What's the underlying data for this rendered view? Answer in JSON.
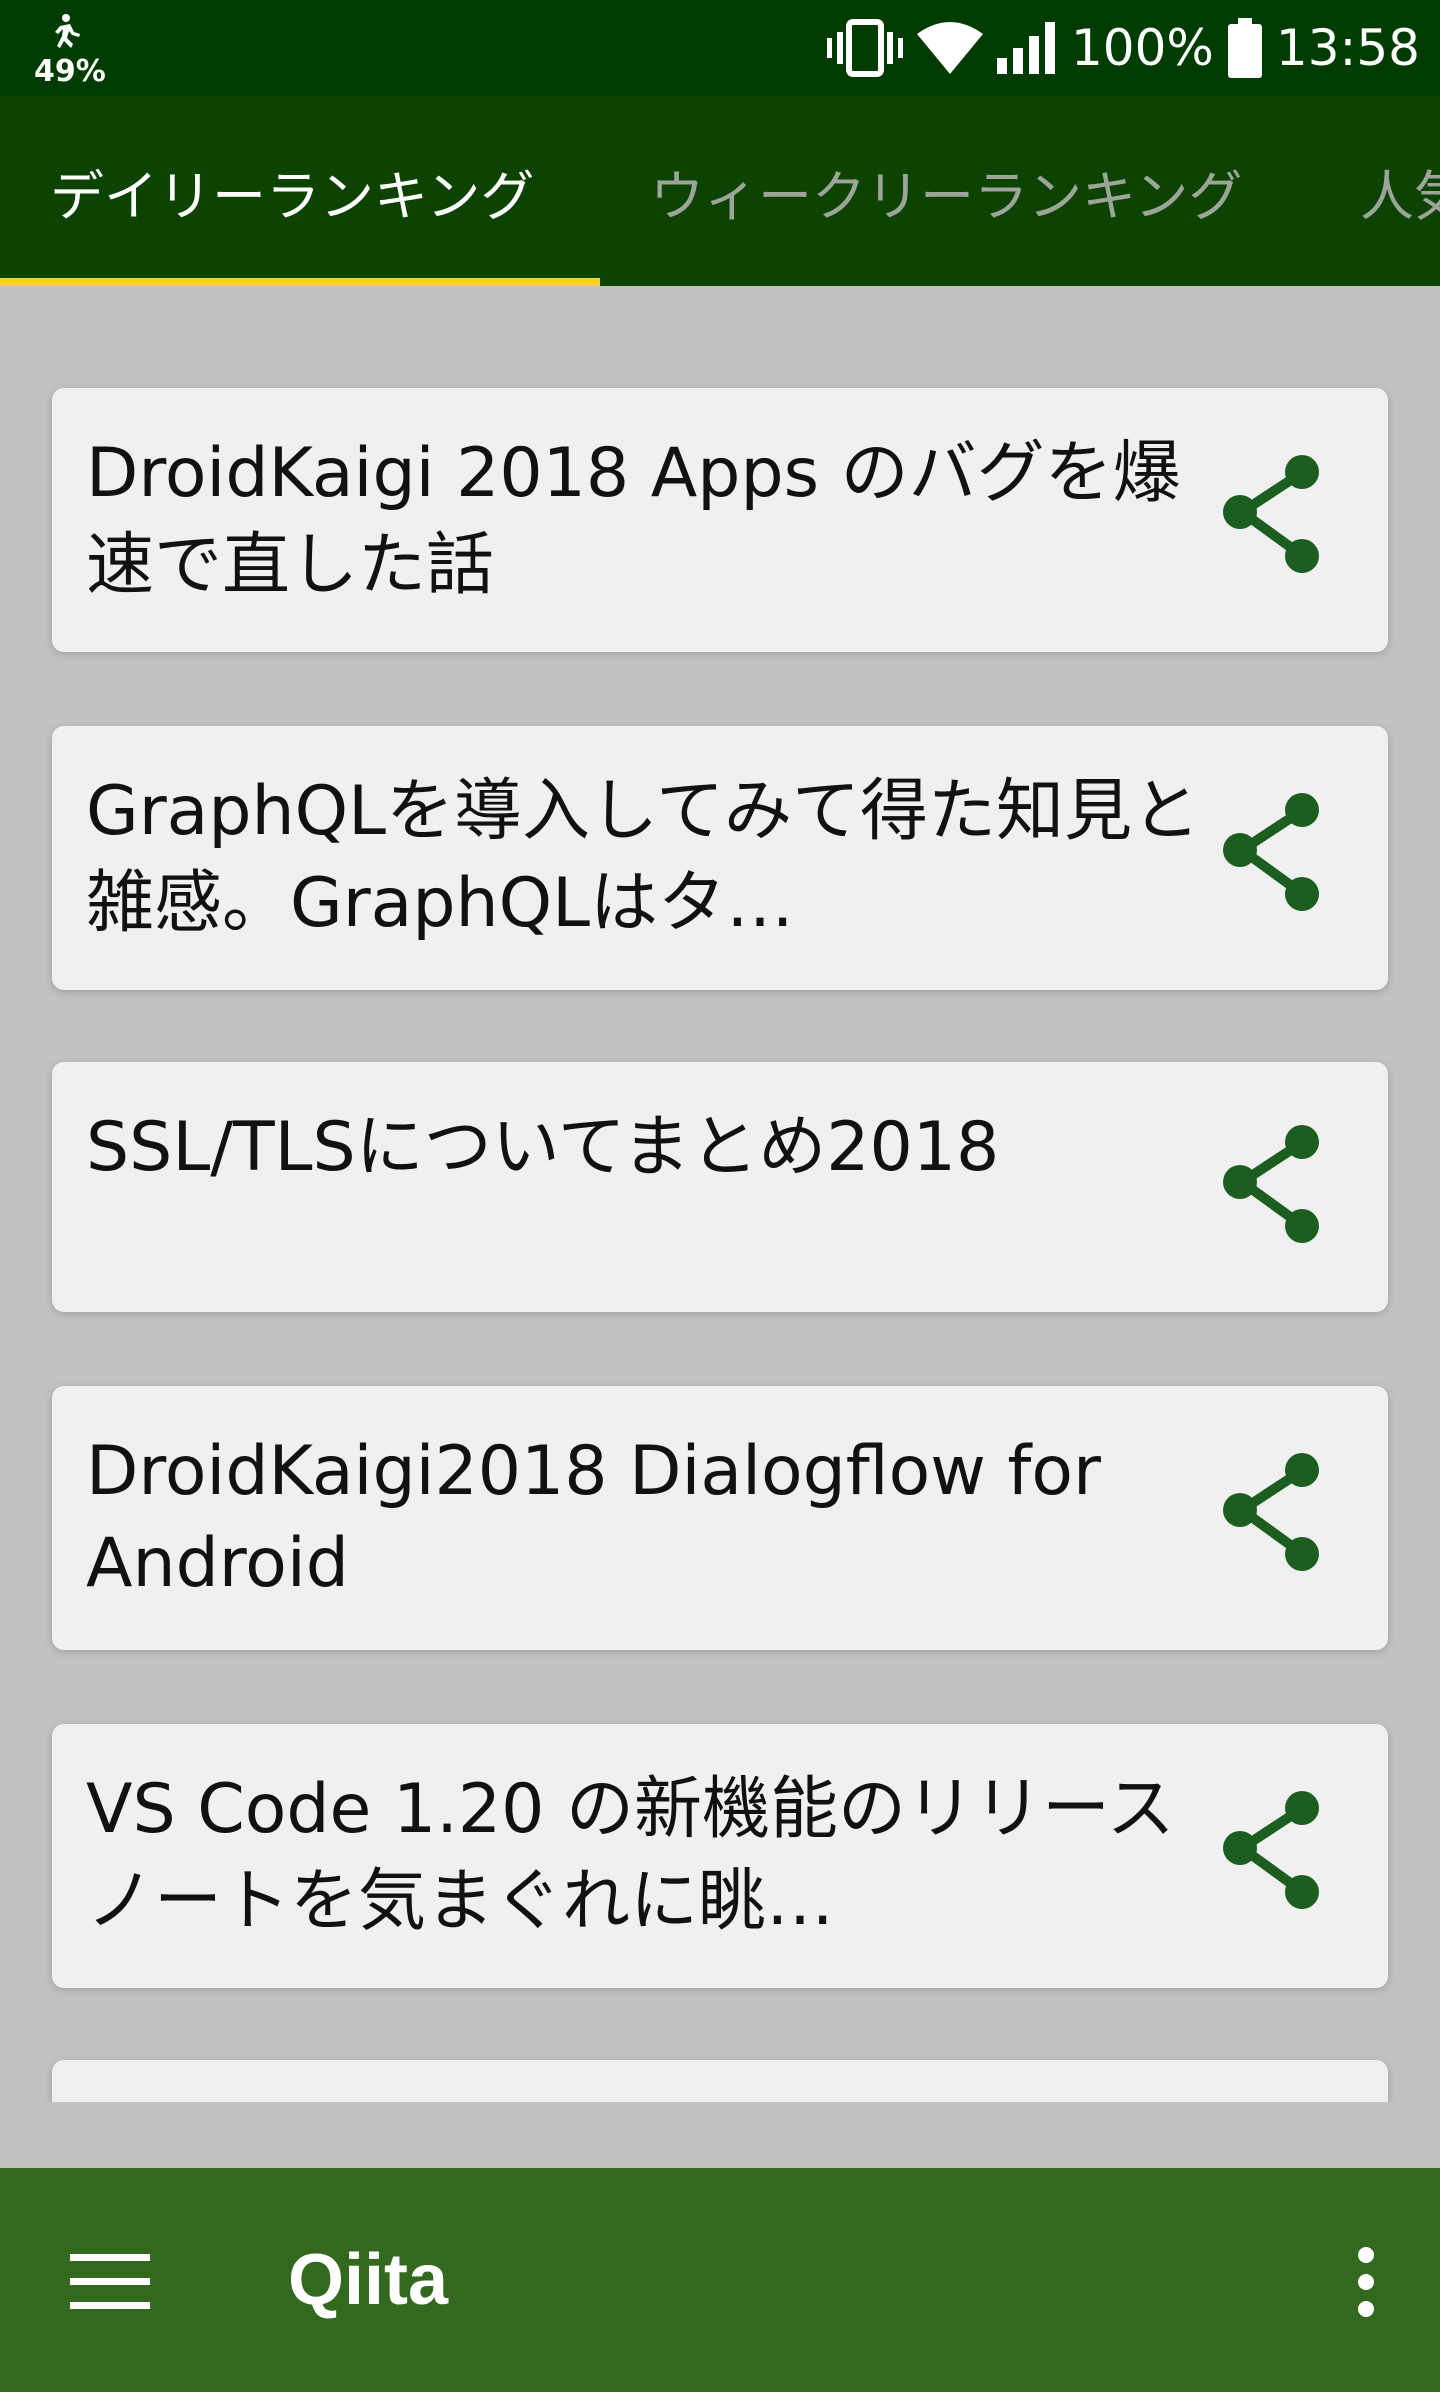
{
  "status_bar": {
    "left_battery_percent": "49%",
    "battery_percent": "100%",
    "time": "13:58",
    "icons": [
      "person-running-icon",
      "vibrate-icon",
      "wifi-icon",
      "cell-signal-icon",
      "battery-icon"
    ]
  },
  "tabs": [
    {
      "label": "デイリーランキング",
      "selected": true
    },
    {
      "label": "ウィークリーランキング",
      "selected": false
    },
    {
      "label": "人気",
      "selected": false
    }
  ],
  "articles": [
    {
      "title": "DroidKaigi 2018 Apps のバグを爆速で直した話",
      "action_icon": "share-icon"
    },
    {
      "title": "GraphQLを導入してみて得た知見と雑感。GraphQLはタ…",
      "action_icon": "share-icon"
    },
    {
      "title": "SSL/TLSについてまとめ2018",
      "action_icon": "share-icon"
    },
    {
      "title": "DroidKaigi2018 Dialogflow for Android",
      "action_icon": "share-icon"
    },
    {
      "title": "VS Code 1.20 の新機能のリリースノートを気まぐれに眺…",
      "action_icon": "share-icon"
    }
  ],
  "bottom_bar": {
    "title": "Qiita",
    "menu_icon": "hamburger-menu-icon",
    "more_icon": "more-vertical-icon"
  },
  "colors": {
    "status_bar": "#003b00",
    "tab_bar": "#0d4300",
    "tab_indicator": "#f6d02d",
    "bottom_bar": "#33691e",
    "background": "#c2c2c2",
    "card": "#f0f0f0",
    "share_icon": "#1b5e20"
  }
}
